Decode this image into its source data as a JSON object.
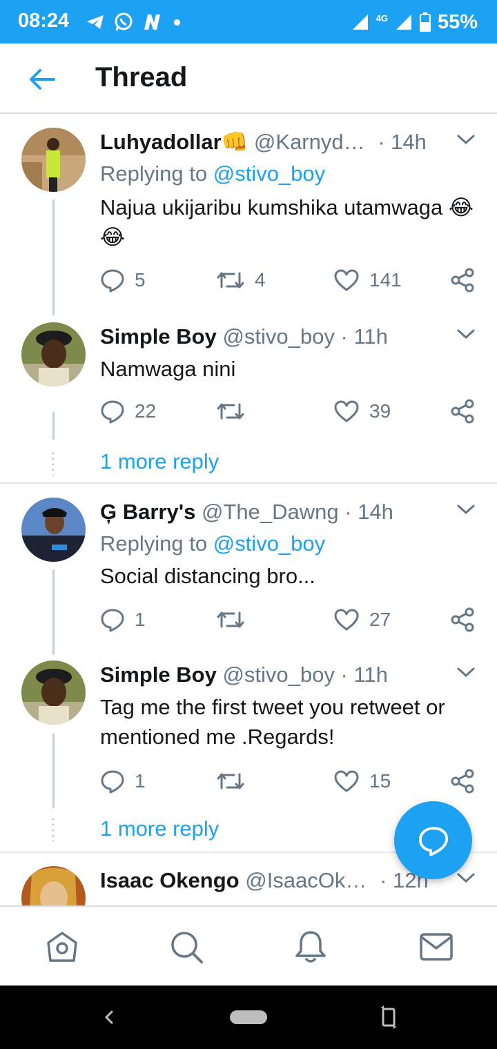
{
  "status_bar": {
    "time": "08:24",
    "network": "4G",
    "battery": "55%"
  },
  "header": {
    "title": "Thread"
  },
  "tweets": [
    {
      "name": "Luhyadollar👊",
      "handle": "@Karnyd…",
      "time": "· 14h",
      "replying_prefix": "Replying to ",
      "replying_to": "@stivo_boy",
      "text": "Najua ukijaribu kumshika utamwaga 😂😂",
      "replies": "5",
      "retweets": "4",
      "likes": "141"
    },
    {
      "name": "Simple Boy",
      "handle": "@stivo_boy",
      "time": "· 11h",
      "text": "Namwaga nini",
      "replies": "22",
      "retweets": "",
      "likes": "39",
      "more_replies": "1 more reply"
    },
    {
      "name": "Ģ Barry's",
      "handle": "@The_Dawng",
      "time": "· 14h",
      "replying_prefix": "Replying to ",
      "replying_to": "@stivo_boy",
      "text": "Social distancing bro...",
      "replies": "1",
      "retweets": "",
      "likes": "27"
    },
    {
      "name": "Simple Boy",
      "handle": "@stivo_boy",
      "time": "· 11h",
      "text": "Tag me the first tweet you retweet or mentioned me .Regards!",
      "replies": "1",
      "retweets": "",
      "likes": "15",
      "more_replies": "1 more reply"
    },
    {
      "name": "Isaac Okengo",
      "handle": "@IsaacOk…",
      "time": "· 12h"
    }
  ],
  "colors": {
    "accent": "#1da1f2",
    "secondary_text": "#657786",
    "primary_text": "#14171a"
  },
  "bottom_nav": [
    "home-icon",
    "search-icon",
    "notifications-icon",
    "messages-icon"
  ]
}
